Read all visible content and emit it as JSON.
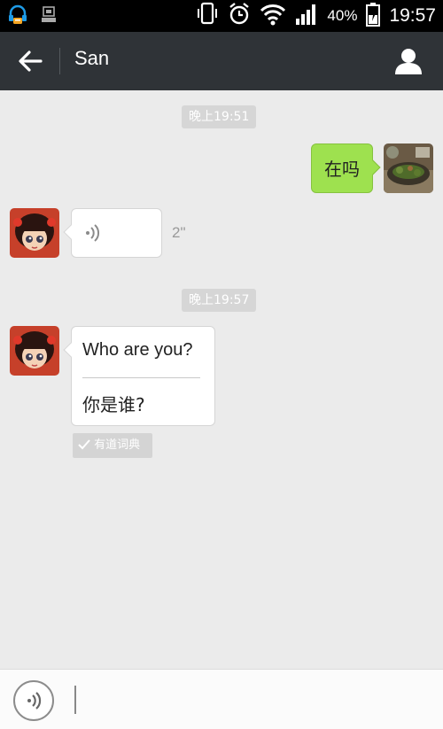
{
  "status_bar": {
    "battery_percent": "40%",
    "time": "19:57",
    "icons": [
      "headset-notification-icon",
      "download-icon",
      "vibrate-icon",
      "alarm-icon",
      "wifi-icon",
      "signal-icon",
      "battery-charging-icon"
    ]
  },
  "header": {
    "title": "San",
    "back_icon": "back-arrow-icon",
    "profile_icon": "contact-icon",
    "color": "#2f3337"
  },
  "messages": {
    "time1": "晚上19:51",
    "sent_text": "在吗",
    "voice_duration": "2\"",
    "time2": "晚上19:57",
    "translation_original": "Who are you?",
    "translation_result": "你是谁?",
    "translation_source": "有道词典"
  },
  "input_bar": {
    "voice_icon": "voice-wave-icon",
    "input_value": "",
    "input_placeholder": ""
  },
  "colors": {
    "sent_bubble": "#9ee14f",
    "received_bubble": "#ffffff",
    "background": "#ebebeb"
  }
}
